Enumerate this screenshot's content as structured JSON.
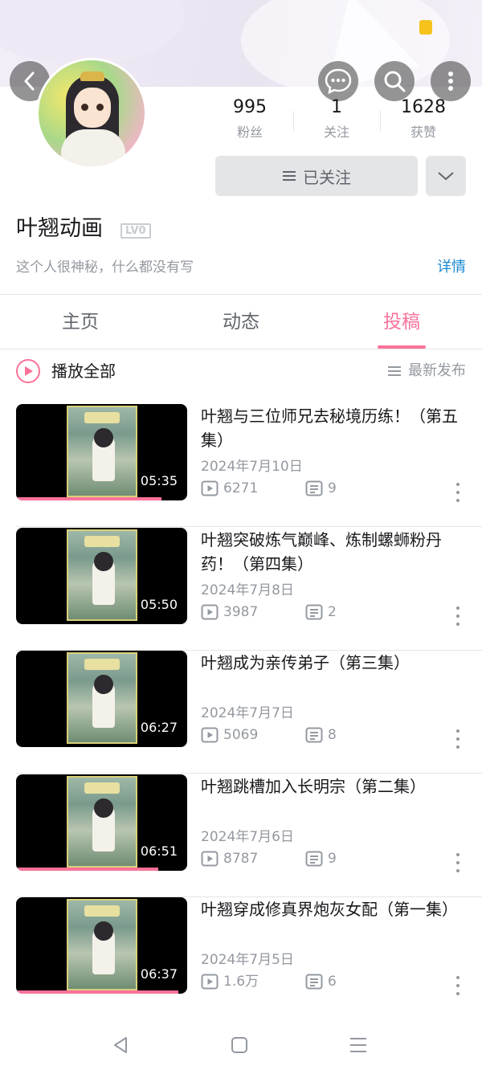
{
  "banner": {
    "back_icon": "chevron-left-icon",
    "message_icon": "chat-bubble-icon",
    "search_icon": "search-icon",
    "more_icon": "more-vertical-icon"
  },
  "profile": {
    "stats": [
      {
        "value": "995",
        "label": "粉丝"
      },
      {
        "value": "1",
        "label": "关注"
      },
      {
        "value": "1628",
        "label": "获赞"
      }
    ],
    "follow_label": "已关注",
    "username": "叶翘动画",
    "level": "LV0",
    "bio": "这个人很神秘，什么都没有写",
    "detail_link": "详情"
  },
  "tabs": [
    {
      "label": "主页",
      "active": false
    },
    {
      "label": "动态",
      "active": false
    },
    {
      "label": "投稿",
      "active": true
    }
  ],
  "toolbar": {
    "play_all": "播放全部",
    "sort": "最新发布"
  },
  "videos": [
    {
      "title": "叶翘与三位师兄去秘境历练！（第五集）",
      "date": "2024年7月10日",
      "plays": "6271",
      "comments": "9",
      "duration": "05:35",
      "progress": 0.85
    },
    {
      "title": "叶翘突破炼气巅峰、炼制螺蛳粉丹药！（第四集）",
      "date": "2024年7月8日",
      "plays": "3987",
      "comments": "2",
      "duration": "05:50",
      "progress": 0.0
    },
    {
      "title": "叶翘成为亲传弟子（第三集）",
      "date": "2024年7月7日",
      "plays": "5069",
      "comments": "8",
      "duration": "06:27",
      "progress": 0.0
    },
    {
      "title": "叶翘跳槽加入长明宗（第二集）",
      "date": "2024年7月6日",
      "plays": "8787",
      "comments": "9",
      "duration": "06:51",
      "progress": 0.83
    },
    {
      "title": "叶翘穿成修真界炮灰女配（第一集）",
      "date": "2024年7月5日",
      "plays": "1.6万",
      "comments": "6",
      "duration": "06:37",
      "progress": 0.95
    }
  ],
  "colors": {
    "accent": "#fb7299",
    "link": "#1a8ad2",
    "muted": "#9499a0"
  }
}
